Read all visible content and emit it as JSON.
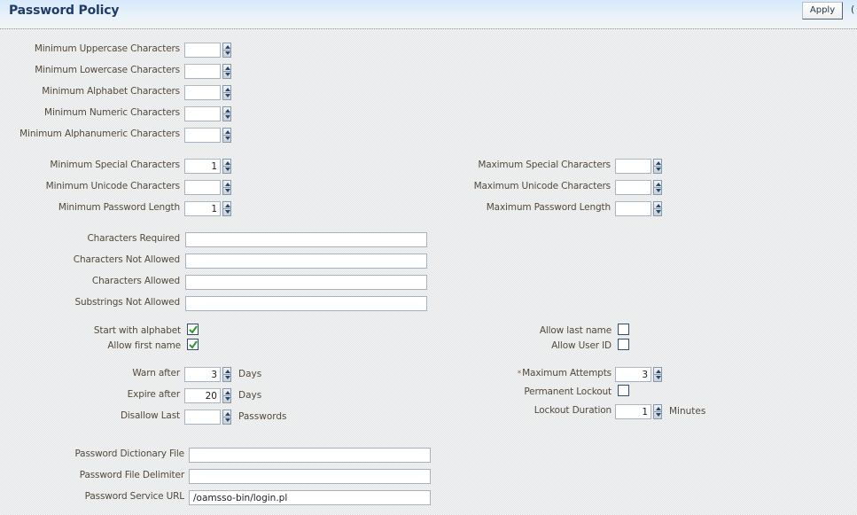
{
  "header": {
    "title": "Password Policy",
    "apply_label": "Apply",
    "overflow_glyph": "("
  },
  "character_minimums": [
    {
      "label": "Minimum Uppercase Characters",
      "value": ""
    },
    {
      "label": "Minimum Lowercase Characters",
      "value": ""
    },
    {
      "label": "Minimum Alphabet Characters",
      "value": ""
    },
    {
      "label": "Minimum Numeric Characters",
      "value": ""
    },
    {
      "label": "Minimum Alphanumeric Characters",
      "value": ""
    }
  ],
  "min_limits": [
    {
      "label": "Minimum Special Characters",
      "value": "1"
    },
    {
      "label": "Minimum Unicode Characters",
      "value": ""
    },
    {
      "label": "Minimum Password Length",
      "value": "1"
    }
  ],
  "max_limits": [
    {
      "label": "Maximum Special Characters",
      "value": ""
    },
    {
      "label": "Maximum Unicode Characters",
      "value": ""
    },
    {
      "label": "Maximum Password Length",
      "value": ""
    }
  ],
  "character_rules": [
    {
      "label": "Characters Required",
      "value": ""
    },
    {
      "label": "Characters Not Allowed",
      "value": ""
    },
    {
      "label": "Characters Allowed",
      "value": ""
    },
    {
      "label": "Substrings Not Allowed",
      "value": ""
    }
  ],
  "checkboxes_left": [
    {
      "label": "Start with alphabet",
      "checked": true
    },
    {
      "label": "Allow first name",
      "checked": true
    }
  ],
  "checkboxes_right": [
    {
      "label": "Allow last name",
      "checked": false
    },
    {
      "label": "Allow User ID",
      "checked": false
    }
  ],
  "expiry": {
    "warn_after": {
      "label": "Warn after",
      "value": "3",
      "unit": "Days"
    },
    "expire_after": {
      "label": "Expire after",
      "value": "20",
      "unit": "Days"
    },
    "disallow_last": {
      "label": "Disallow Last",
      "value": "",
      "unit": "Passwords"
    }
  },
  "lockout": {
    "required_marker": "*",
    "max_attempts": {
      "label": "Maximum Attempts",
      "value": "3"
    },
    "permanent_lockout": {
      "label": "Permanent Lockout",
      "checked": false
    },
    "lockout_duration": {
      "label": "Lockout Duration",
      "value": "1",
      "unit": "Minutes"
    }
  },
  "files": [
    {
      "label": "Password Dictionary File",
      "value": ""
    },
    {
      "label": "Password File Delimiter",
      "value": ""
    },
    {
      "label": "Password Service URL",
      "value": "/oamsso-bin/login.pl"
    }
  ],
  "colors": {
    "title": "#1f3d66",
    "label": "#54493a",
    "check": "#2e9a2e"
  }
}
